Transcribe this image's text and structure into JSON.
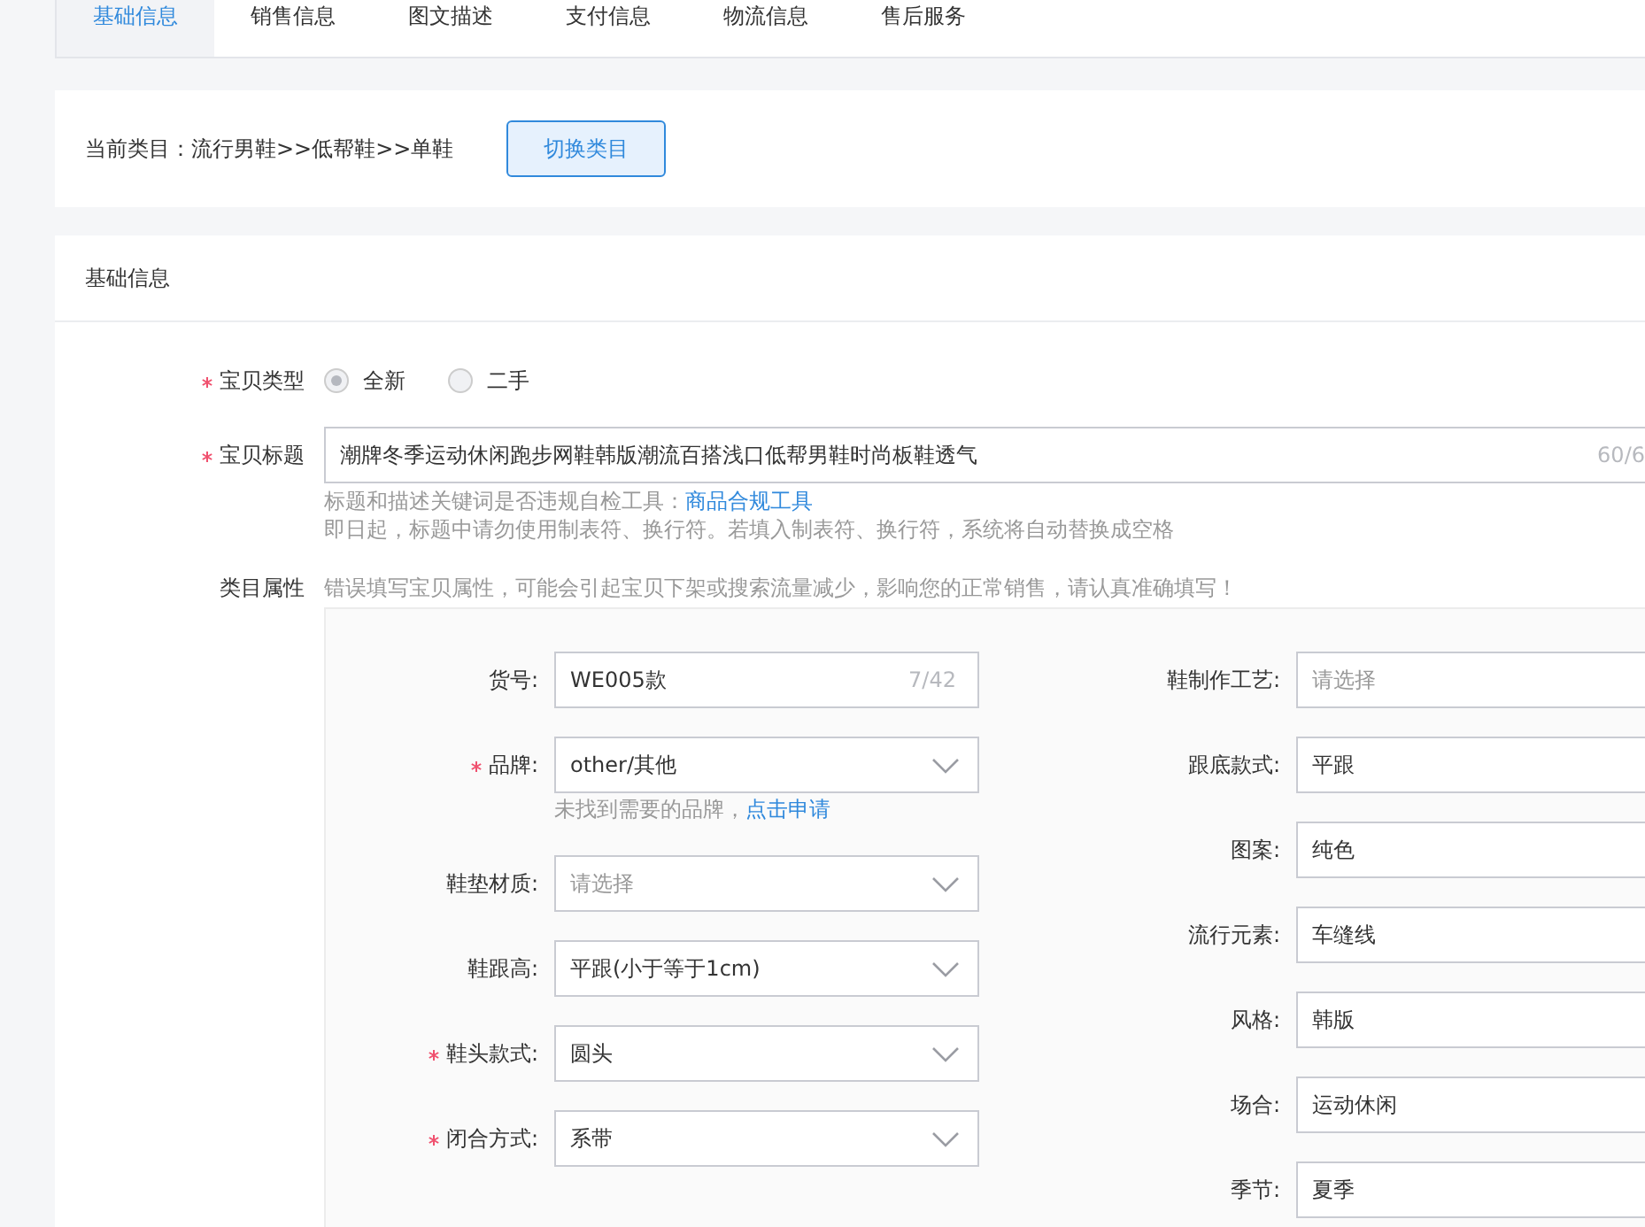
{
  "tabs": [
    {
      "label": "基础信息",
      "selected": true
    },
    {
      "label": "销售信息",
      "selected": false
    },
    {
      "label": "图文描述",
      "selected": false
    },
    {
      "label": "支付信息",
      "selected": false
    },
    {
      "label": "物流信息",
      "selected": false
    },
    {
      "label": "售后服务",
      "selected": false
    }
  ],
  "category": {
    "text": "当前类目：流行男鞋>>低帮鞋>>单鞋",
    "button": "切换类目"
  },
  "section": {
    "title": "基础信息",
    "item_type": {
      "label": "宝贝类型",
      "required": true,
      "options": [
        {
          "label": "全新",
          "selected": true
        },
        {
          "label": "二手",
          "selected": false
        }
      ]
    },
    "item_title": {
      "label": "宝贝标题",
      "required": true,
      "value": "潮牌冬季运动休闲跑步网鞋韩版潮流百搭浅口低帮男鞋时尚板鞋透气",
      "counter": "60/6",
      "hint_prefix": "标题和描述关键词是否违规自检工具：",
      "hint_link": "商品合规工具",
      "hint_2": "即日起，标题中请勿使用制表符、换行符。若填入制表符、换行符，系统将自动替换成空格"
    },
    "attributes": {
      "label": "类目属性",
      "warning": "错误填写宝贝属性，可能会引起宝贝下架或搜索流量减少，影响您的正常销售，请认真准确填写！",
      "left": [
        {
          "label": "货号:",
          "kind": "input",
          "required": false,
          "value": "WE005款",
          "counter": "7/42"
        },
        {
          "label": "品牌:",
          "kind": "select",
          "required": true,
          "value": "other/其他",
          "hint": "未找到需要的品牌，",
          "hint_link": "点击申请"
        },
        {
          "label": "鞋垫材质:",
          "kind": "select",
          "required": false,
          "placeholder": "请选择"
        },
        {
          "label": "鞋跟高:",
          "kind": "select",
          "required": false,
          "value": "平跟(小于等于1cm)"
        },
        {
          "label": "鞋头款式:",
          "kind": "select",
          "required": true,
          "value": "圆头"
        },
        {
          "label": "闭合方式:",
          "kind": "select",
          "required": true,
          "value": "系带"
        }
      ],
      "right": [
        {
          "label": "鞋制作工艺:",
          "kind": "plain",
          "required": false,
          "placeholder": "请选择"
        },
        {
          "label": "跟底款式:",
          "kind": "plain",
          "required": false,
          "value": "平跟"
        },
        {
          "label": "图案:",
          "kind": "plain",
          "required": false,
          "value": "纯色"
        },
        {
          "label": "流行元素:",
          "kind": "plain",
          "required": false,
          "value": "车缝线"
        },
        {
          "label": "风格:",
          "kind": "plain",
          "required": false,
          "value": "韩版"
        },
        {
          "label": "场合:",
          "kind": "plain",
          "required": false,
          "value": "运动休闲"
        },
        {
          "label": "季节:",
          "kind": "plain",
          "required": false,
          "value": "夏季"
        }
      ]
    }
  }
}
